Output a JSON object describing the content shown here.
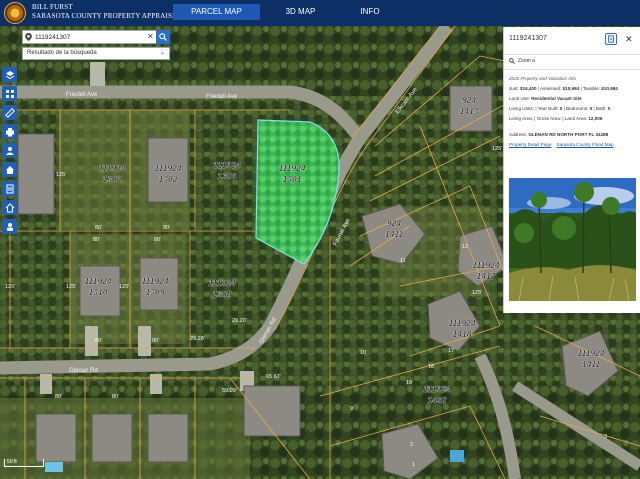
{
  "header": {
    "brand_line1": "BILL FURST",
    "brand_line2": "SARASOTA COUNTY PROPERTY APPRAISER",
    "tabs": [
      "PARCEL MAP",
      "3D MAP",
      "INFO"
    ],
    "active_tab": "PARCEL MAP"
  },
  "search": {
    "value": "1119241307",
    "results_label": "Resultado de la búsqueda"
  },
  "toolbar": {
    "tools": [
      "layers-icon",
      "grid-icon",
      "ruler-icon",
      "print-icon",
      "share-icon",
      "home-icon",
      "reports-icon",
      "home-alt-icon",
      "user-icon"
    ]
  },
  "map": {
    "scale_label": "50 ft",
    "streets": [
      "Friedell Ave",
      "Friedell Ave",
      "Glenan Rd",
      "Glenan Rd",
      "Faunal Ave",
      "Elkcam Ave"
    ],
    "parcels": [
      {
        "id": "111924",
        "lot": "1302"
      },
      {
        "id": "111924",
        "lot": "1306"
      },
      {
        "id": "111924",
        "lot": "1301"
      },
      {
        "id": "924",
        "lot": "1413"
      },
      {
        "id": "924",
        "lot": "1411"
      },
      {
        "id": "111924",
        "lot": "1417"
      },
      {
        "id": "111924",
        "lot": "1310"
      },
      {
        "id": "111924",
        "lot": "1309"
      },
      {
        "id": "111924",
        "lot": "1308"
      },
      {
        "id": "111924",
        "lot": "1418"
      },
      {
        "id": "111924",
        "lot": "1411"
      },
      {
        "id": "111924",
        "lot": "1432"
      }
    ],
    "dimensions": [
      "80'",
      "80'",
      "125'",
      "80'",
      "80'",
      "125'",
      "80'",
      "80'",
      "125'",
      "125'",
      "59.09'",
      "65.67'",
      "29.28'",
      "29.20'",
      "125'",
      "125'",
      "80'",
      "80'",
      "11",
      "12",
      "17",
      "18",
      "19",
      "9",
      "10",
      "2",
      "1",
      "3"
    ],
    "colors": {
      "selected_fill": "#3fd36a",
      "selected_stroke": "#7ee8ff",
      "parcel_line": "#e7a84a"
    }
  },
  "info_panel": {
    "parcel_id": "1119241307",
    "zoom_label": "Zoom a",
    "values_title": "2026 Property and Valuation Info",
    "just_label": "Just:",
    "just_value": "$16,400",
    "assessed_label": "Assessed:",
    "assessed_value": "$10,984",
    "taxable_label": "Taxable:",
    "taxable_value": "$10,984",
    "land_use_label": "Land Use:",
    "land_use_value": "Residential Vacant Site",
    "living_units_label": "Living Units:",
    "living_units_value": "",
    "year_built_label": "Year Built:",
    "year_built_value": "0",
    "bedrooms_label": "Bedrooms:",
    "bedrooms_value": "0",
    "bath_label": "Bath:",
    "bath_value": "0",
    "living_area_label": "Living Area:",
    "living_area_value": "",
    "gross_area_label": "Gross Area:",
    "gross_area_value": "",
    "land_area_label": "Land Area:",
    "land_area_value": "12,006",
    "address_label": "Address:",
    "address_value": "GLENAN RD NORTH PORT FL 34288",
    "link_detail": "Property Detail Page",
    "link_flood": "Sarasota County Flood Map"
  }
}
